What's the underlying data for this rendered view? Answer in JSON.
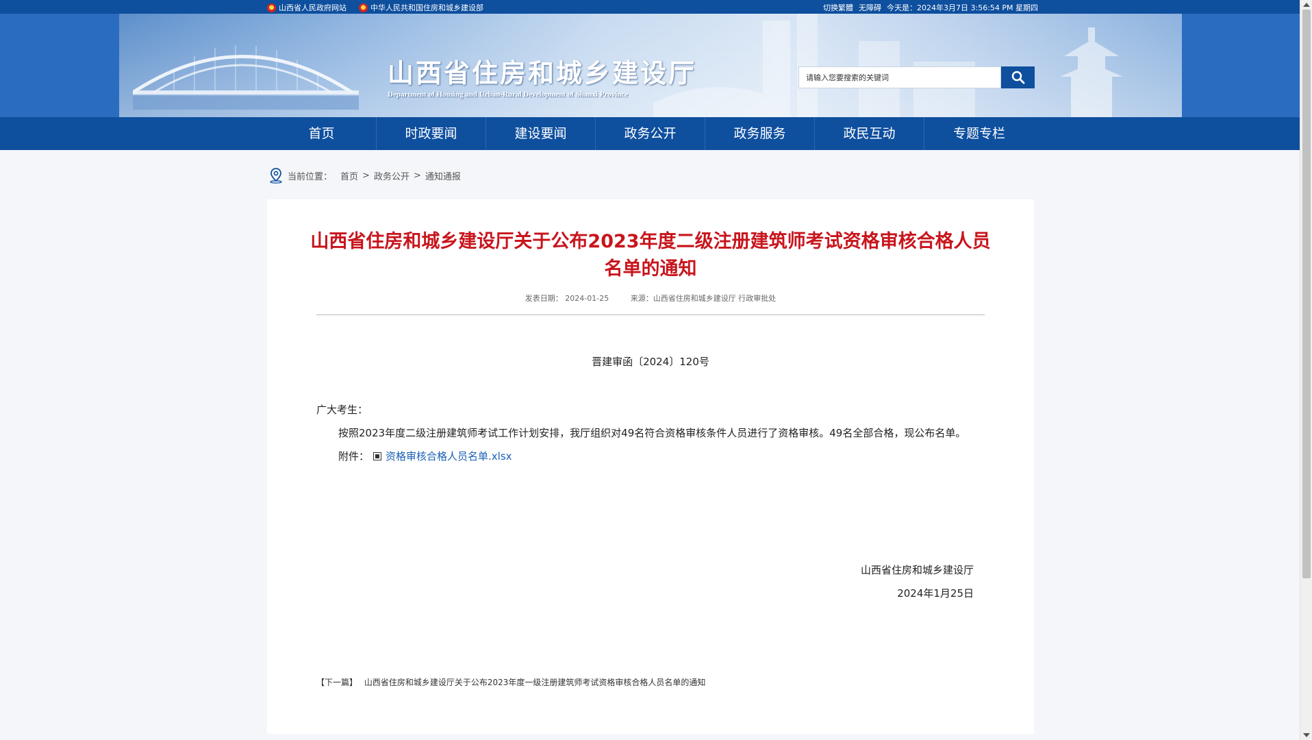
{
  "topbar": {
    "link1": "山西省人民政府网站",
    "link2": "中华人民共和国住房和城乡建设部",
    "switch_lang": "切换繁體",
    "accessibility": "无障碍",
    "today": "今天是：2024年3月7日 3:56:54 PM 星期四"
  },
  "header": {
    "title": "山西省住房和城乡建设厅",
    "subtitle": "Department of Housing and Urban-Rural Development of Shanxi Province",
    "search_placeholder": "请输入您要搜索的关键词"
  },
  "nav": {
    "items": [
      "首页",
      "时政要闻",
      "建设要闻",
      "政务公开",
      "政务服务",
      "政民互动",
      "专题专栏"
    ]
  },
  "breadcrumb": {
    "label": "当前位置：",
    "items": [
      "首页",
      "政务公开",
      "通知通报"
    ],
    "separator": ">"
  },
  "article": {
    "title": "山西省住房和城乡建设厅关于公布2023年度二级注册建筑师考试资格审核合格人员名单的通知",
    "date": "发表日期： 2024-01-25",
    "source": "来源：山西省住房和城乡建设厅 行政审批处",
    "doc_number": "晋建审函〔2024〕120号",
    "greeting": "广大考生：",
    "paragraph": "按照2023年度二级注册建筑师考试工作计划安排，我厅组织对49名符合资格审核条件人员进行了资格审核。49名全部合格，现公布名单。",
    "attachment_label": "附件：",
    "attachment_link": "资格审核合格人员名单.xlsx",
    "signature_org": "山西省住房和城乡建设厅",
    "signature_date": "2024年1月25日",
    "next_label": "【下一篇】",
    "next_title": "山西省住房和城乡建设厅关于公布2023年度一级注册建筑师考试资格审核合格人员名单的通知"
  },
  "colors": {
    "primary_blue": "#0e4f9e",
    "title_red": "#c8151d",
    "link_blue": "#1a5fb4"
  }
}
